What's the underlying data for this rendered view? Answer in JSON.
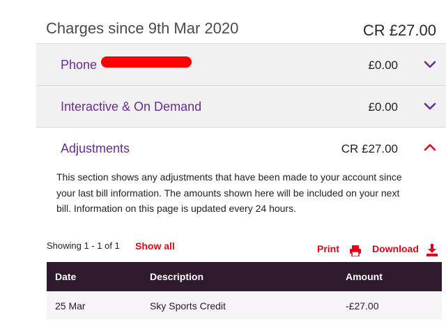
{
  "header": {
    "title": "Charges since 9th Mar 2020",
    "total": "CR £27.00"
  },
  "sections": [
    {
      "label": "Phone",
      "amount": "£0.00",
      "expanded": false
    },
    {
      "label": "Interactive & On Demand",
      "amount": "£0.00",
      "expanded": false
    },
    {
      "label": "Adjustments",
      "amount": "CR £27.00",
      "expanded": true
    }
  ],
  "adjustments": {
    "description": "This section shows any adjustments that have been made to your account since your last bill information. The amounts shown here will be included on your next bill. Information on this page is updated every 24 hours.",
    "showing": "Showing 1 - 1 of 1",
    "show_all": "Show all",
    "print_label": "Print",
    "download_label": "Download",
    "table": {
      "columns": [
        "Date",
        "Description",
        "Amount"
      ],
      "rows": [
        {
          "date": "25 Mar",
          "description": "Sky Sports Credit",
          "amount": "-£27.00"
        }
      ]
    }
  },
  "colors": {
    "accent_purple": "#6a2c91",
    "accent_red": "#e3001b",
    "table_header": "#2e1a2c",
    "redaction": "#ff0000"
  },
  "icons": [
    "chevron-down-icon",
    "chevron-up-icon",
    "printer-icon",
    "download-icon"
  ]
}
